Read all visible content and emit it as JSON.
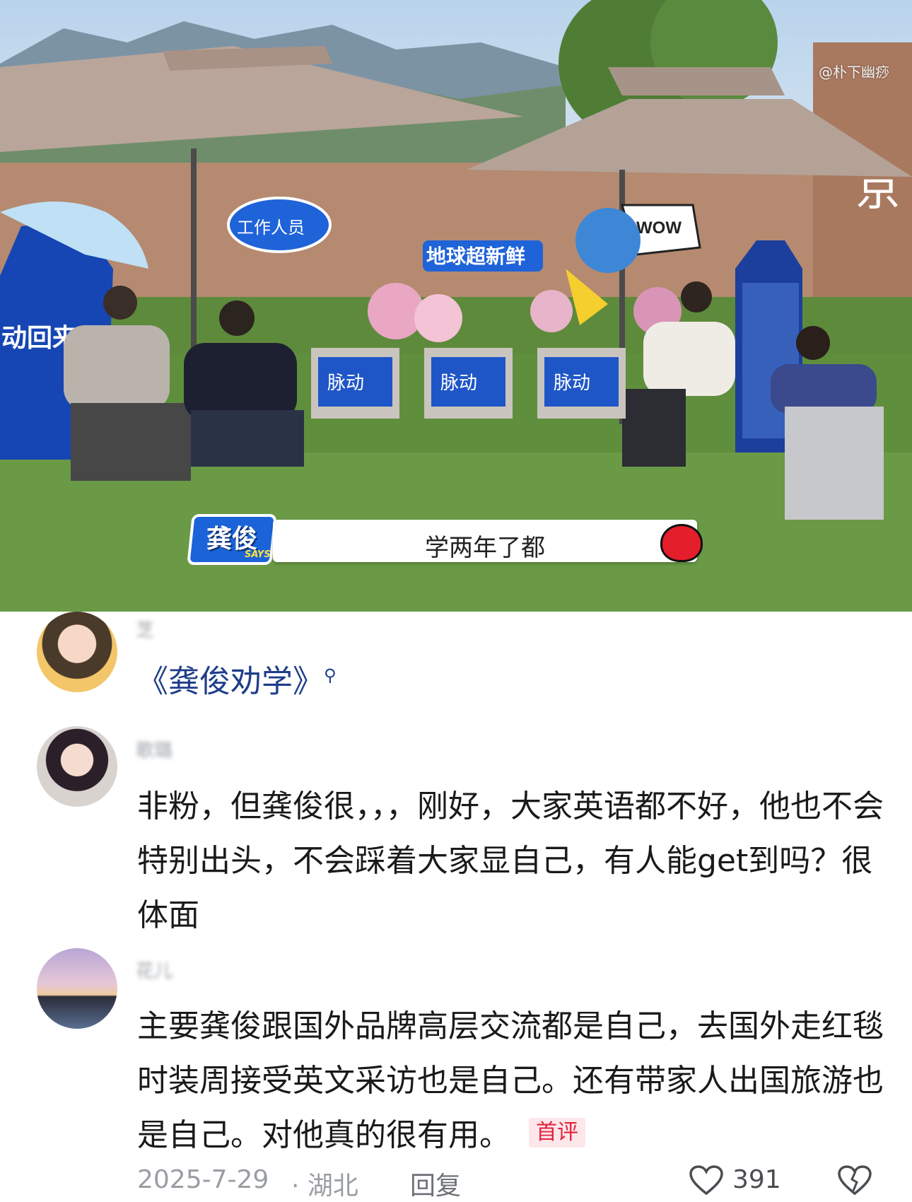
{
  "video": {
    "watermark": "@朴下幽痧",
    "caption": {
      "speaker": "龚俊",
      "says_tag": "SAYS",
      "text": "学两年了都"
    },
    "signs": {
      "staff_sign": "工作人员",
      "chair_brand": "脉动",
      "show_title": "地球超新鲜",
      "wow_sign": "WOW",
      "wall_char": "京",
      "banner_left": "动回来"
    }
  },
  "comments": [
    {
      "username": "芝",
      "text": "《龚俊劝学》",
      "has_search_icon": true
    },
    {
      "username": "歌璐",
      "text": "非粉，但龚俊很，，，刚好，大家英语都不好，他也不会特别出头，不会踩着大家显自己，有人能get到吗？很体面"
    },
    {
      "username": "花儿",
      "text": "主要龚俊跟国外品牌高层交流都是自己，去国外走红毯时装周接受英文采访也是自己。还有带家人出国旅游也是自己。对他真的很有用。",
      "badge": "首评",
      "date": "2025-7-29",
      "location": "· 湖北",
      "reply_label": "回复",
      "likes": "391"
    }
  ],
  "colors": {
    "accent_blue": "#1b63d8",
    "badge_red": "#e2233f",
    "hashtag_blue": "#1f3d8a"
  }
}
